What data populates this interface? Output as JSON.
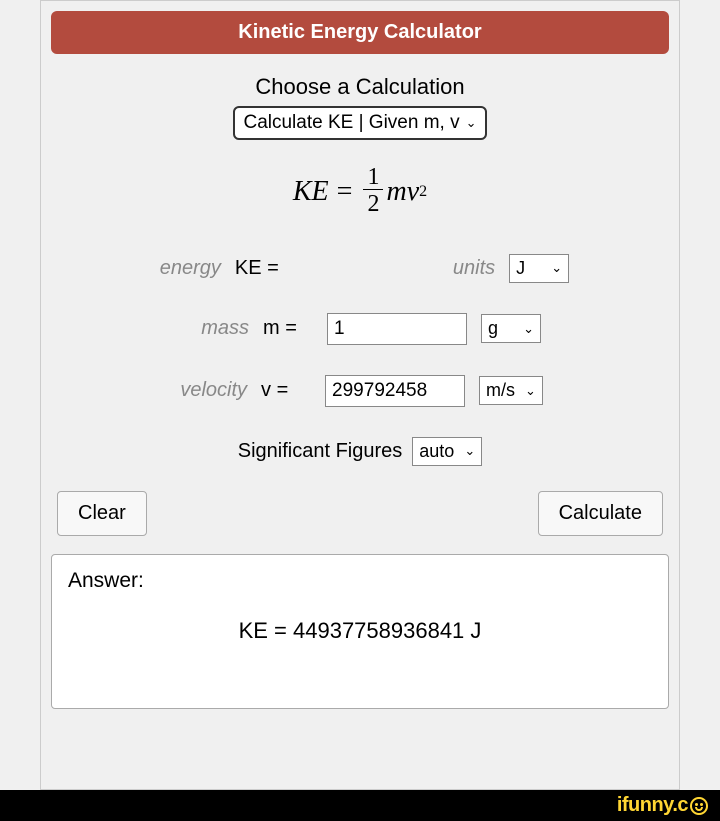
{
  "header": {
    "title": "Kinetic Energy Calculator"
  },
  "choose": {
    "label": "Choose a Calculation",
    "selected": "Calculate KE | Given m, v"
  },
  "formula": {
    "lhs": "KE",
    "eq": "=",
    "frac_num": "1",
    "frac_den": "2",
    "rhs_m": "m",
    "rhs_v": "v",
    "rhs_exp": "2"
  },
  "fields": {
    "energy": {
      "desc": "energy",
      "symbol": "KE =",
      "value": "",
      "units_label": "units",
      "unit": "J"
    },
    "mass": {
      "desc": "mass",
      "symbol": "m =",
      "value": "1",
      "unit": "g"
    },
    "velocity": {
      "desc": "velocity",
      "symbol": "v =",
      "value": "299792458",
      "unit": "m/s"
    }
  },
  "sigfig": {
    "label": "Significant Figures",
    "value": "auto"
  },
  "buttons": {
    "clear": "Clear",
    "calculate": "Calculate"
  },
  "answer": {
    "label": "Answer:",
    "result": "KE = 44937758936841 J"
  },
  "watermark": {
    "text": "ifunny.c"
  }
}
